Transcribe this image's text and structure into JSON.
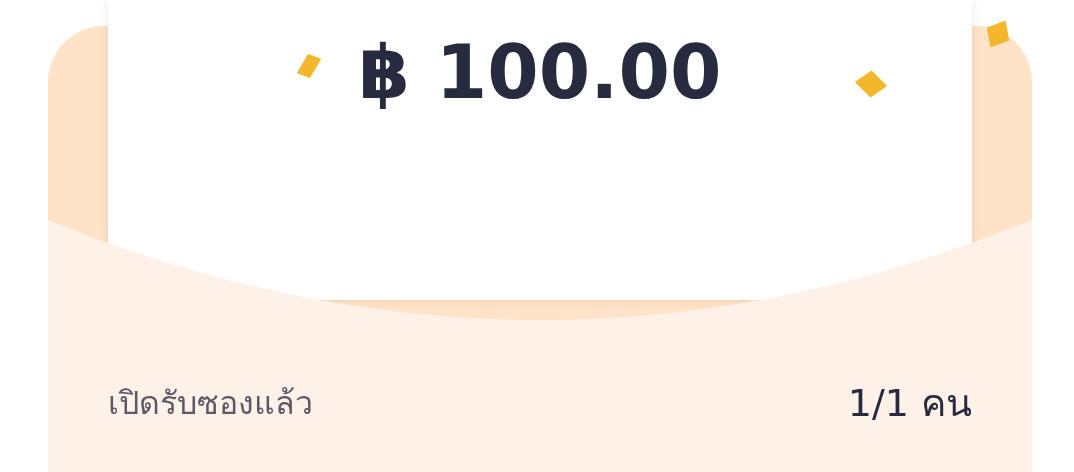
{
  "amount": "฿ 100.00",
  "rows": [
    {
      "label": "เปิดรับซองแล้ว",
      "value": "1/1 คน"
    }
  ]
}
